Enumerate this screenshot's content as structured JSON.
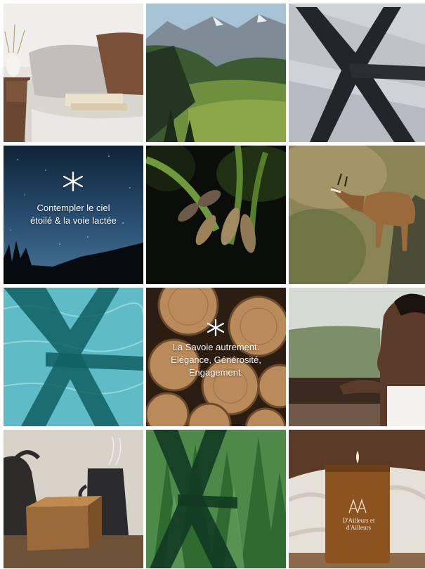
{
  "tiles": [
    {
      "id": "bedroom",
      "alt": "bedroom-pillows"
    },
    {
      "id": "mountains",
      "alt": "mountain-valley"
    },
    {
      "id": "fur",
      "alt": "fur-texture-logo"
    },
    {
      "id": "night",
      "alt": "starry-night",
      "lines": [
        "Contempler le ciel",
        "étoilé & la voie lactée"
      ]
    },
    {
      "id": "asparagus",
      "alt": "asparagus"
    },
    {
      "id": "chamois",
      "alt": "chamois"
    },
    {
      "id": "water",
      "alt": "water-logo"
    },
    {
      "id": "logs",
      "alt": "wood-logs",
      "lines": [
        "La Savoie autrement.",
        "Elégance, Générosité,",
        "Engagement."
      ]
    },
    {
      "id": "bath",
      "alt": "hot-tub-woman"
    },
    {
      "id": "teapot",
      "alt": "tea-table"
    },
    {
      "id": "forest",
      "alt": "forest-logo"
    },
    {
      "id": "candle",
      "alt": "candle",
      "brand_lines": [
        "D'Ailleurs et",
        "d'Ailleurs"
      ]
    }
  ],
  "colors": {
    "logo_dark": "#1a2b2c",
    "logo_teal": "#0f5f63",
    "forest_dark": "#123a22"
  }
}
